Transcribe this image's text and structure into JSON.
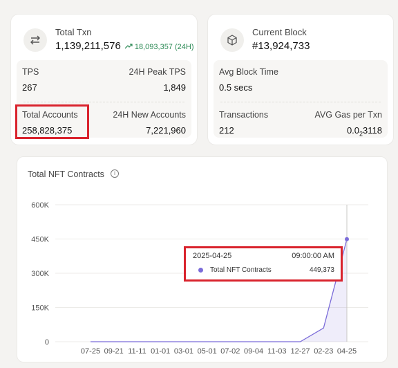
{
  "total_txn": {
    "label": "Total Txn",
    "value": "1,139,211,576",
    "change": "18,093,357 (24H)",
    "icon": "transfer-arrows-icon",
    "stats": {
      "tps_label": "TPS",
      "tps_value": "267",
      "peak_label": "24H Peak TPS",
      "peak_value": "1,849",
      "accounts_label": "Total Accounts",
      "accounts_value": "258,828,375",
      "new_accounts_label": "24H New Accounts",
      "new_accounts_value": "7,221,960"
    }
  },
  "current_block": {
    "label": "Current Block",
    "value": "#13,924,733",
    "icon": "cube-icon",
    "stats": {
      "block_time_label": "Avg Block Time",
      "block_time_value": "0.5 secs",
      "txns_label": "Transactions",
      "txns_value": "212",
      "gas_label": "AVG Gas per Txn",
      "gas_value_main": "0.0",
      "gas_value_sub": "2",
      "gas_value_tail": "3118"
    }
  },
  "nft_chart": {
    "title": "Total NFT Contracts",
    "tooltip": {
      "date": "2025-04-25",
      "time": "09:00:00 AM",
      "series": "Total NFT Contracts",
      "value": "449,373"
    }
  },
  "colors": {
    "accent": "#7b6cd9",
    "positive": "#2e8b57",
    "highlight": "#d9232d"
  },
  "chart_data": {
    "type": "area",
    "title": "Total NFT Contracts",
    "x": [
      "07-25",
      "09-21",
      "11-11",
      "01-01",
      "03-01",
      "05-01",
      "07-02",
      "09-04",
      "11-03",
      "12-27",
      "02-23",
      "04-25"
    ],
    "series": [
      {
        "name": "Total NFT Contracts",
        "values": [
          0,
          0,
          0,
          0,
          0,
          0,
          0,
          0,
          0,
          0,
          60000,
          449373
        ]
      }
    ],
    "y_ticks": [
      "0",
      "150K",
      "300K",
      "450K",
      "600K"
    ],
    "ylim": [
      0,
      600000
    ],
    "grid": true
  }
}
